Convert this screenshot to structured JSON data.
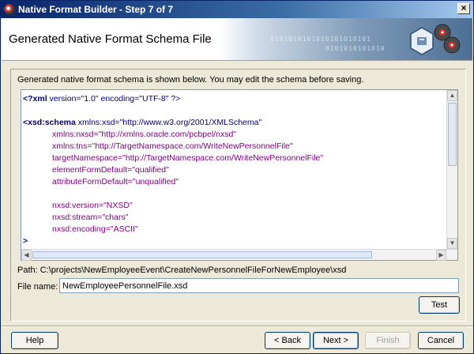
{
  "window": {
    "title": "Native Format Builder - Step 7 of 7",
    "close_glyph": "×"
  },
  "header": {
    "title": "Generated Native Format Schema File",
    "binary_text": "0101010101010101010101",
    "binary_text2": "0101010101010"
  },
  "intro_text": "Generated native format schema is shown below. You may edit the schema before saving.",
  "code_lines": [
    {
      "tag": "<?xml",
      "rest": " version=\"1.0\" encoding=\"UTF-8\" ?>"
    },
    {
      "tag": "",
      "rest": ""
    },
    {
      "tag": "<xsd:schema",
      "rest": " xmlns:xsd=\"http://www.w3.org/2001/XMLSchema\""
    },
    {
      "tag": "",
      "rest": "xmlns:nxsd=\"http://xmlns.oracle.com/pcbpel/nxsd\"",
      "indent": true
    },
    {
      "tag": "",
      "rest": "xmlns:tns=\"http://TargetNamespace.com/WriteNewPersonnelFile\"",
      "indent": true
    },
    {
      "tag": "",
      "rest": "targetNamespace=\"http://TargetNamespace.com/WriteNewPersonnelFile\"",
      "indent": true
    },
    {
      "tag": "",
      "rest": "elementFormDefault=\"qualified\"",
      "indent": true
    },
    {
      "tag": "",
      "rest": "attributeFormDefault=\"unqualified\"",
      "indent": true
    },
    {
      "tag": "",
      "rest": ""
    },
    {
      "tag": "",
      "rest": "nxsd:version=\"NXSD\"",
      "indent": true
    },
    {
      "tag": "",
      "rest": "nxsd:stream=\"chars\"",
      "indent": true
    },
    {
      "tag": "",
      "rest": "nxsd:encoding=\"ASCII\"",
      "indent": true
    },
    {
      "tag": ">",
      "rest": ""
    }
  ],
  "path_text": "Path: C:\\projects\\NewEmployeeEvent\\CreateNewPersonnelFileForNewEmployee\\xsd",
  "filename": {
    "label": "File name:",
    "value": "NewEmployeePersonnelFile.xsd"
  },
  "buttons": {
    "test": "Test",
    "help": "Help",
    "back": "< Back",
    "next": "Next >",
    "finish": "Finish",
    "cancel": "Cancel"
  },
  "scroll_glyphs": {
    "up": "▲",
    "down": "▼",
    "left": "◀",
    "right": "▶"
  },
  "colors": {
    "titlebar": "#0a246a",
    "tag": "#000080",
    "attr": "#800080"
  }
}
